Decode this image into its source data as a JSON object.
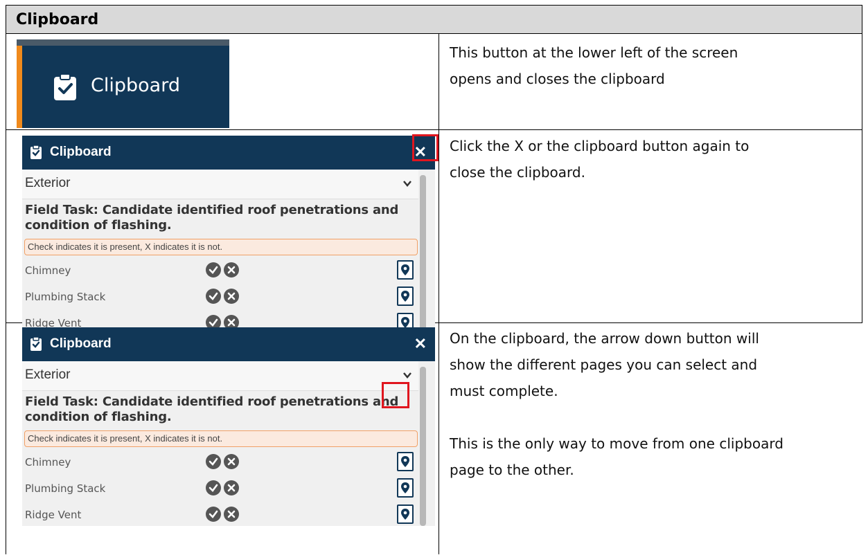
{
  "header": {
    "title": "Clipboard"
  },
  "rows": [
    {
      "description": [
        "This button at the lower left of the screen",
        "opens and closes the clipboard"
      ]
    },
    {
      "description": [
        "Click the X or the clipboard button again to",
        "close the clipboard."
      ]
    },
    {
      "description": [
        "On the clipboard, the arrow down button will",
        "show the different pages you can select and",
        "must complete."
      ],
      "description2": [
        "This is the only way to move from one clipboard",
        "page to the other."
      ]
    }
  ],
  "button_shot": {
    "label": "Clipboard"
  },
  "panel": {
    "title": "Clipboard",
    "close_glyph": "✕",
    "selected_page": "Exterior",
    "task": "Field Task: Candidate identified roof penetrations and condition of flashing.",
    "note": "Check indicates it is present, X indicates it is not.",
    "items": [
      {
        "name": "Chimney"
      },
      {
        "name": "Plumbing Stack"
      },
      {
        "name": "Ridge Vent"
      }
    ]
  },
  "colors": {
    "navy": "#113757",
    "orange_accent": "#f08a1c",
    "highlight_red": "#e0161f",
    "header_gray": "#d9d9d9"
  },
  "icons": [
    "clipboard-check-icon",
    "close-icon",
    "chevron-down-icon",
    "check-circle-icon",
    "x-circle-icon",
    "map-pin-icon"
  ]
}
